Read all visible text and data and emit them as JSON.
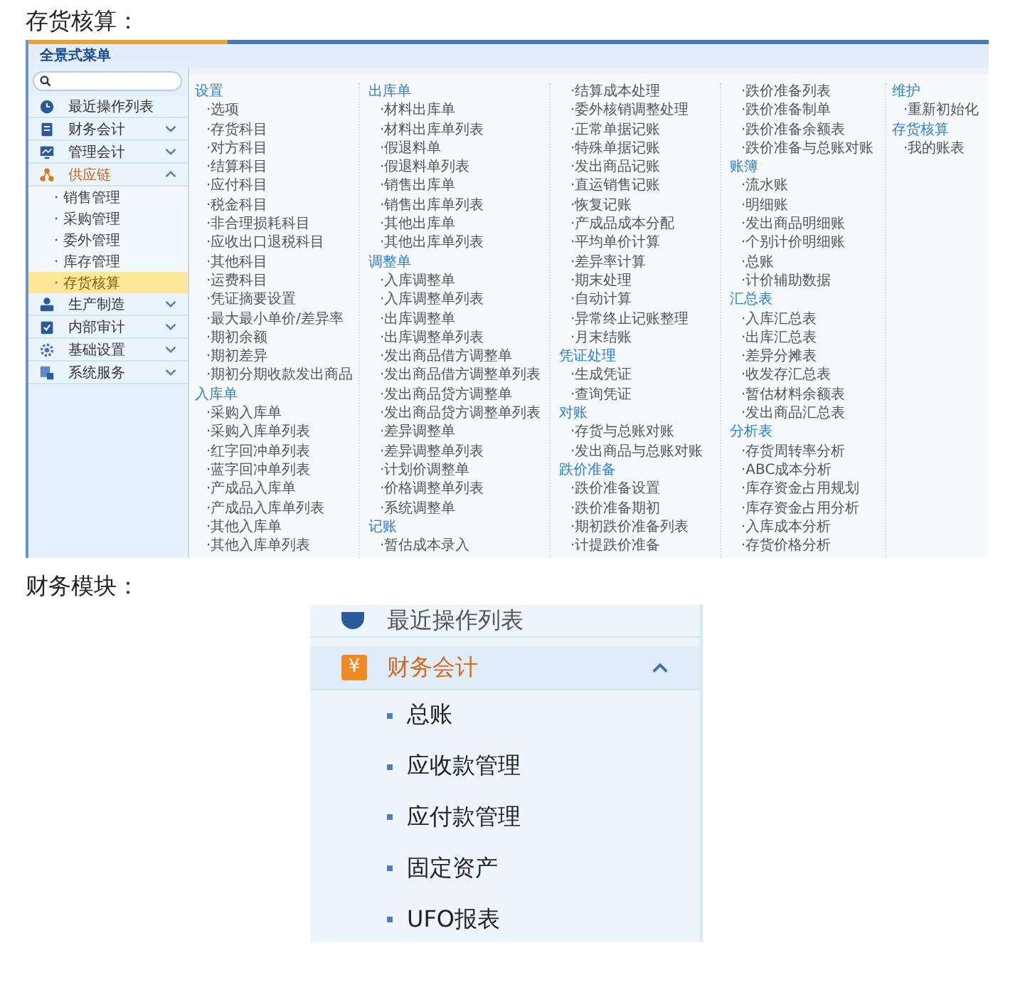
{
  "caption_1": "存货核算：",
  "menu_screenshot": {
    "title": "全景式菜单",
    "sidebar": [
      {
        "label": "最近操作列表",
        "expanded": false,
        "has_arrow": false
      },
      {
        "label": "财务会计",
        "expanded": false,
        "has_arrow": true
      },
      {
        "label": "管理会计",
        "expanded": false,
        "has_arrow": true
      },
      {
        "label": "供应链",
        "expanded": true,
        "has_arrow": true,
        "children": [
          {
            "label": "· 销售管理",
            "selected": false
          },
          {
            "label": "· 采购管理",
            "selected": false
          },
          {
            "label": "· 委外管理",
            "selected": false
          },
          {
            "label": "· 库存管理",
            "selected": false
          },
          {
            "label": "· 存货核算",
            "selected": true
          }
        ]
      },
      {
        "label": "生产制造",
        "expanded": false,
        "has_arrow": true
      },
      {
        "label": "内部审计",
        "expanded": false,
        "has_arrow": true
      },
      {
        "label": "基础设置",
        "expanded": false,
        "has_arrow": true
      },
      {
        "label": "系统服务",
        "expanded": false,
        "has_arrow": true
      }
    ],
    "columns": [
      {
        "groups": [
          {
            "title": "设置",
            "items": [
              "·选项",
              "·存货科目",
              "·对方科目",
              "·结算科目",
              "·应付科目",
              "·税金科目",
              "·非合理损耗科目",
              "·应收出口退税科目",
              "·其他科目",
              "·运费科目",
              "·凭证摘要设置",
              "·最大最小单价/差异率",
              "·期初余额",
              "·期初差异",
              "·期初分期收款发出商品"
            ]
          },
          {
            "title": "入库单",
            "items": [
              "·采购入库单",
              "·采购入库单列表",
              "·红字回冲单列表",
              "·蓝字回冲单列表",
              "·产成品入库单",
              "·产成品入库单列表",
              "·其他入库单",
              "·其他入库单列表"
            ]
          }
        ]
      },
      {
        "groups": [
          {
            "title": "出库单",
            "items": [
              "·材料出库单",
              "·材料出库单列表",
              "·假退料单",
              "·假退料单列表",
              "·销售出库单",
              "·销售出库单列表",
              "·其他出库单",
              "·其他出库单列表"
            ]
          },
          {
            "title": "调整单",
            "items": [
              "·入库调整单",
              "·入库调整单列表",
              "·出库调整单",
              "·出库调整单列表",
              "·发出商品借方调整单",
              "·发出商品借方调整单列表",
              "·发出商品贷方调整单",
              "·发出商品贷方调整单列表",
              "·差异调整单",
              "·差异调整单列表",
              "·计划价调整单",
              "·价格调整单列表",
              "·系统调整单"
            ]
          },
          {
            "title": "记账",
            "items": [
              "·暂估成本录入"
            ]
          }
        ]
      },
      {
        "groups": [
          {
            "items": [
              "·结算成本处理",
              "·委外核销调整处理",
              "·正常单据记账",
              "·特殊单据记账",
              "·发出商品记账",
              "·直运销售记账",
              "·恢复记账",
              "·产成品成本分配",
              "·平均单价计算",
              "·差异率计算",
              "·期末处理",
              "·自动计算",
              "·异常终止记账整理",
              "·月末结账"
            ]
          },
          {
            "title": "凭证处理",
            "items": [
              "·生成凭证",
              "·查询凭证"
            ]
          },
          {
            "title": "对账",
            "items": [
              "·存货与总账对账",
              "·发出商品与总账对账"
            ]
          },
          {
            "title": "跌价准备",
            "items": [
              "·跌价准备设置",
              "·跌价准备期初",
              "·期初跌价准备列表",
              "·计提跌价准备"
            ]
          }
        ]
      },
      {
        "groups": [
          {
            "items": [
              "·跌价准备列表",
              "·跌价准备制单",
              "·跌价准备余额表",
              "·跌价准备与总账对账"
            ]
          },
          {
            "title": "账簿",
            "items": [
              "·流水账",
              "·明细账",
              "·发出商品明细账",
              "·个别计价明细账",
              "·总账",
              "·计价辅助数据"
            ]
          },
          {
            "title": "汇总表",
            "items": [
              "·入库汇总表",
              "·出库汇总表",
              "·差异分摊表",
              "·收发存汇总表",
              "·暂估材料余额表",
              "·发出商品汇总表"
            ]
          },
          {
            "title": "分析表",
            "items": [
              "·存货周转率分析",
              "·ABC成本分析",
              "·库存资金占用规划",
              "·库存资金占用分析",
              "·入库成本分析",
              "·存货价格分析"
            ]
          }
        ]
      },
      {
        "groups": [
          {
            "title": "维护",
            "items": [
              "·重新初始化"
            ]
          },
          {
            "title": "存货核算",
            "items": [
              "·我的账表"
            ]
          }
        ]
      }
    ]
  },
  "caption_2": "财务模块：",
  "finance_screenshot": {
    "items": [
      {
        "label": "最近操作列表",
        "expanded": false,
        "has_arrow": false
      },
      {
        "label": "财务会计",
        "icon": "¥",
        "expanded": true,
        "has_arrow": true,
        "children": [
          {
            "label": "总账"
          },
          {
            "label": "应收款管理"
          },
          {
            "label": "应付款管理"
          },
          {
            "label": "固定资产"
          },
          {
            "label": "UFO报表"
          }
        ]
      }
    ]
  }
}
